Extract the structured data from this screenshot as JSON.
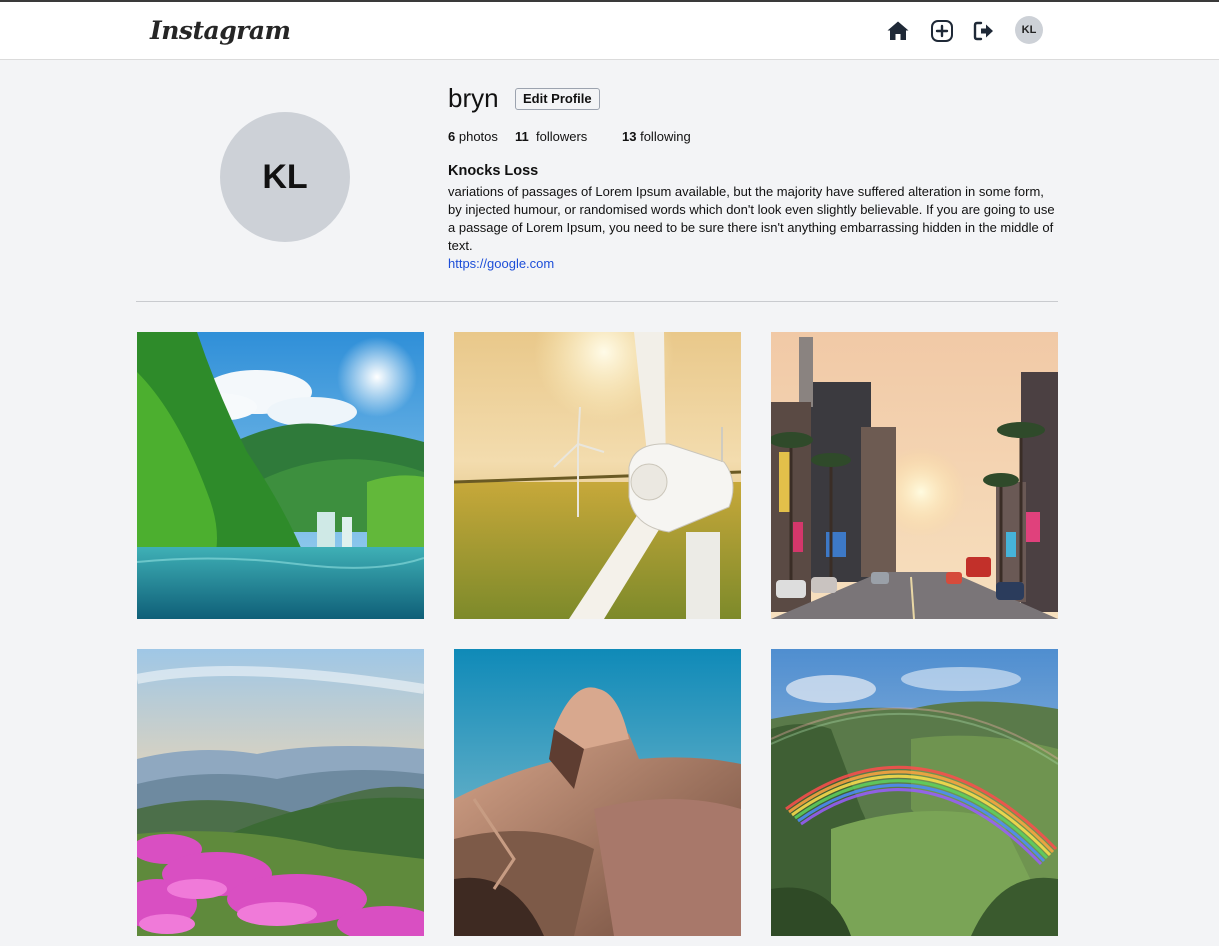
{
  "app": {
    "logo_text": "Instagram"
  },
  "nav": {
    "home_icon": "home-icon",
    "add_icon": "plus-square-icon",
    "logout_icon": "sign-out-icon",
    "avatar_initials": "KL"
  },
  "profile": {
    "avatar_initials": "KL",
    "username": "bryn",
    "edit_button_label": "Edit Profile",
    "stats": {
      "photos_count": "6",
      "photos_label": "photos",
      "followers_count": "11",
      "followers_label": "followers",
      "following_count": "13",
      "following_label": "following"
    },
    "full_name": "Knocks Loss",
    "bio": "variations of passages of Lorem Ipsum available, but the majority have suffered alteration in some form, by injected humour, or randomised words which don't look even slightly believable. If you are going to use a passage of Lorem Ipsum, you need to be sure there isn't anything embarrassing hidden in the middle of text.",
    "link": "https://google.com"
  },
  "photos": [
    {
      "subject": "tropical-lake-waterfall"
    },
    {
      "subject": "wind-turbine-sunset"
    },
    {
      "subject": "city-street-palm-trees"
    },
    {
      "subject": "mountains-pink-flowers"
    },
    {
      "subject": "granite-dome-mountain"
    },
    {
      "subject": "rainbow-over-valley"
    }
  ],
  "colors": {
    "background": "#f3f4f6",
    "link": "#1d4ed8",
    "avatar_bg": "#cdd1d7"
  }
}
